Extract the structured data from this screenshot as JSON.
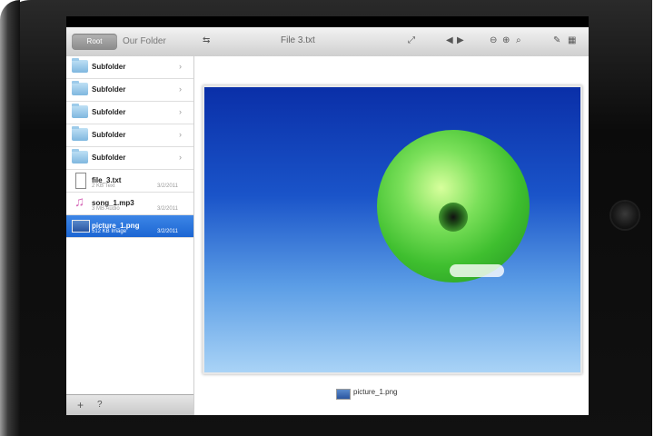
{
  "toolbar": {
    "back_label": "Root",
    "folder_title": "Our Folder",
    "file_title": "File 3.txt"
  },
  "sidebar": {
    "items": [
      {
        "name": "Subfolder",
        "type": "folder"
      },
      {
        "name": "Subfolder",
        "type": "folder"
      },
      {
        "name": "Subfolder",
        "type": "folder"
      },
      {
        "name": "Subfolder",
        "type": "folder"
      },
      {
        "name": "Subfolder",
        "type": "folder"
      },
      {
        "name": "file_3.txt",
        "type": "text",
        "meta": "2 KB Text",
        "date": "3/2/2011"
      },
      {
        "name": "song_1.mp3",
        "type": "audio",
        "meta": "3 MB Audio",
        "date": "3/2/2011"
      },
      {
        "name": "picture_1.png",
        "type": "image",
        "meta": "512 KB Image",
        "date": "3/2/2011",
        "selected": true
      }
    ]
  },
  "preview": {
    "caption": "picture_1.png"
  },
  "colors": {
    "selection": "#1c66d3",
    "balloon": "#3fbf2f",
    "sky": "#1a54c9"
  }
}
